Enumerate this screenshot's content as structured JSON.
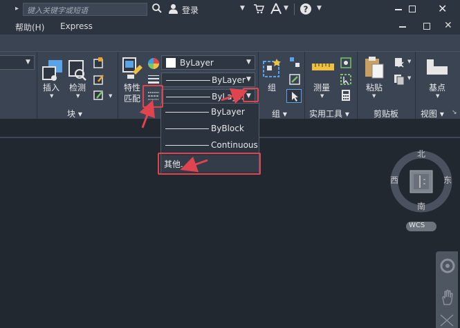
{
  "titlebar": {
    "search_placeholder": "键入关键字或短语",
    "login_label": "登录"
  },
  "menubar": {
    "help": "帮助(H)",
    "express": "Express"
  },
  "ribbon": {
    "insert_label": "插入",
    "inspect_label": "检测",
    "block_panel": "块 ▾",
    "match_label_1": "特性",
    "match_label_2": "匹配",
    "group_label": "组",
    "group_panel": "组 ▾",
    "measure_label": "测量",
    "utilities_panel": "实用工具 ▾",
    "paste_label": "粘贴",
    "clipboard_panel": "剪贴板",
    "basepoint_label": "基点",
    "view_panel": "视图 ▾",
    "color_dropdown": "ByLayer",
    "lineweight_dropdown": "ByLayer",
    "linetype_dropdown": "ByLay..."
  },
  "linetype_list": {
    "items": [
      "ByLayer",
      "ByBlock",
      "Continuous"
    ],
    "other": "其他..."
  },
  "viewcube": {
    "north": "北",
    "south": "南",
    "east": "东",
    "west": "西",
    "wcs": "WCS"
  },
  "colors": {
    "accent_red": "#e0444e",
    "ribbon_bg": "#3b4453",
    "canvas_bg": "#212830"
  }
}
